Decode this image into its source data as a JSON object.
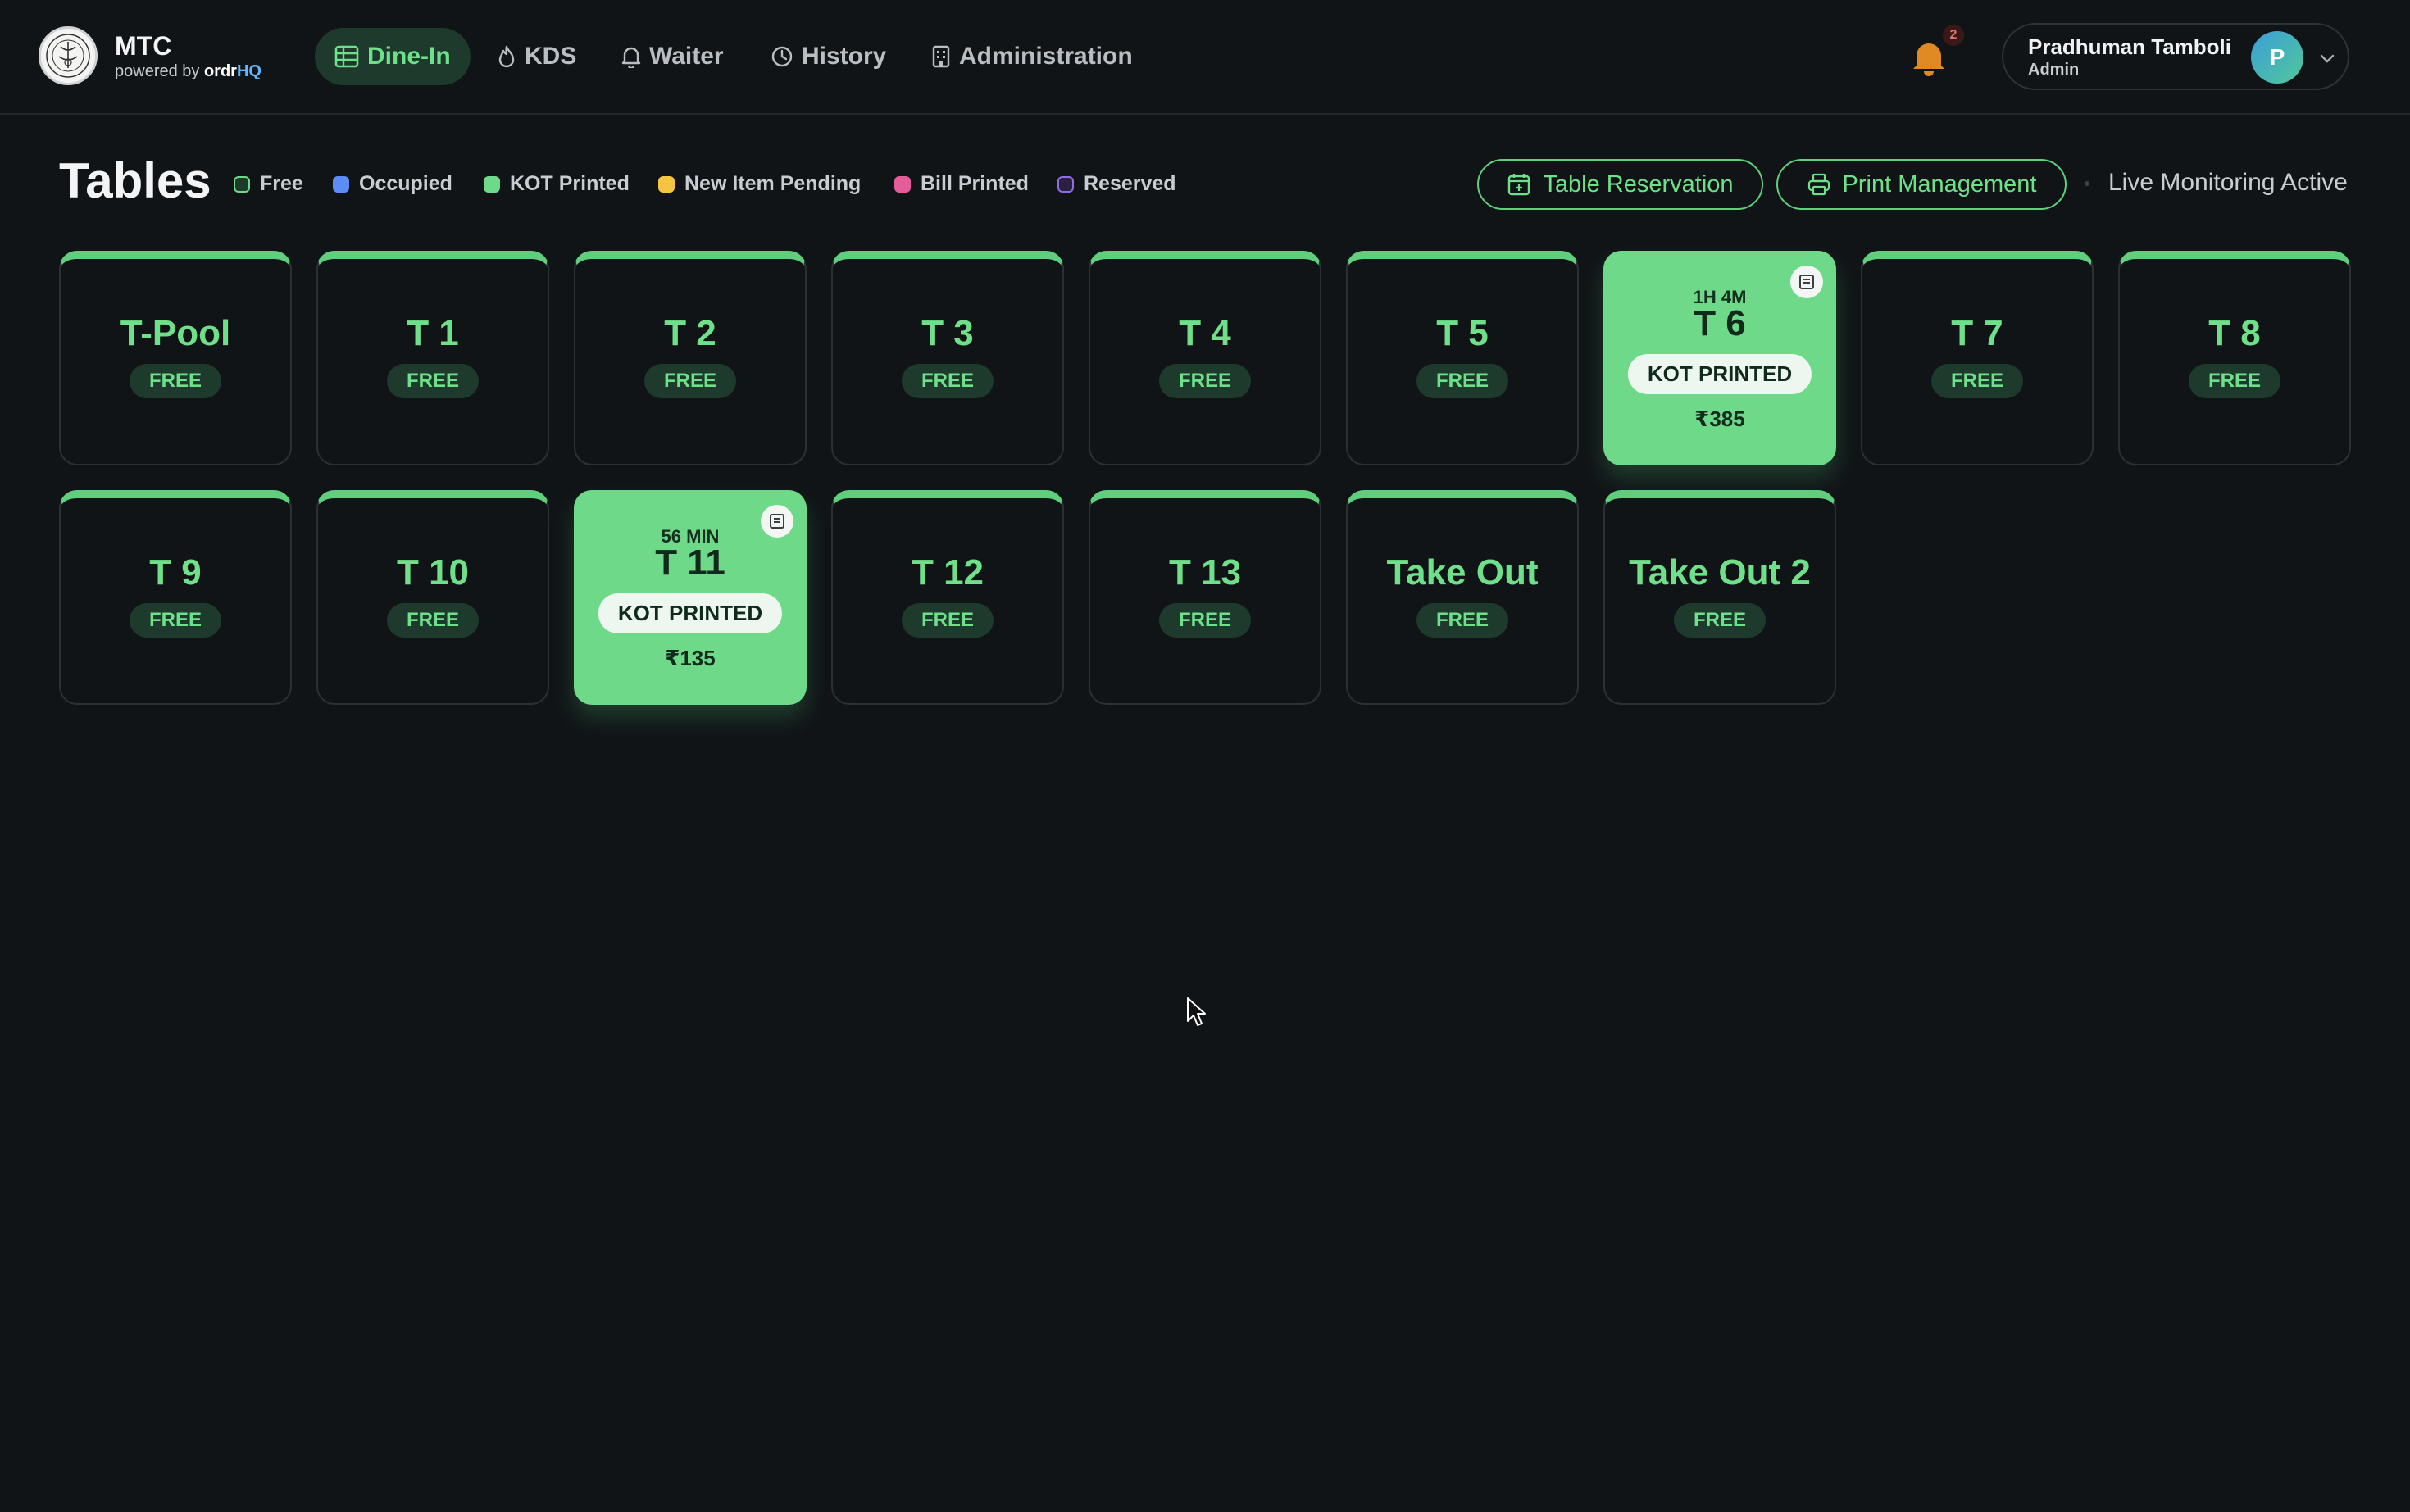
{
  "brand": {
    "name": "MTC",
    "powered_prefix": "powered by",
    "powered_name": "ordr",
    "powered_hq": "HQ"
  },
  "nav": [
    {
      "label": "Dine-In",
      "icon": "table-grid-icon",
      "active": true
    },
    {
      "label": "KDS",
      "icon": "flame-icon",
      "active": false
    },
    {
      "label": "Waiter",
      "icon": "bell-icon",
      "active": false
    },
    {
      "label": "History",
      "icon": "clock-icon",
      "active": false
    },
    {
      "label": "Administration",
      "icon": "building-icon",
      "active": false
    }
  ],
  "notifications": {
    "count": "2"
  },
  "user": {
    "name": "Pradhuman Tamboli",
    "role": "Admin",
    "initial": "P"
  },
  "page": {
    "title": "Tables"
  },
  "legend": [
    {
      "label": "Free",
      "color": "#1e3a2c"
    },
    {
      "label": "Occupied",
      "color": "#5b8df5"
    },
    {
      "label": "KOT Printed",
      "color": "#6fd98a"
    },
    {
      "label": "New Item Pending",
      "color": "#f5c542"
    },
    {
      "label": "Bill Printed",
      "color": "#e45c9a"
    },
    {
      "label": "Reserved",
      "color": "#7a5cc8"
    }
  ],
  "actions": {
    "reservation": "Table Reservation",
    "print": "Print Management",
    "live": "Live Monitoring Active"
  },
  "tables": [
    {
      "name": "T-Pool",
      "status": "FREE"
    },
    {
      "name": "T 1",
      "status": "FREE"
    },
    {
      "name": "T 2",
      "status": "FREE"
    },
    {
      "name": "T 3",
      "status": "FREE"
    },
    {
      "name": "T 4",
      "status": "FREE"
    },
    {
      "name": "T 5",
      "status": "FREE"
    },
    {
      "name": "T 6",
      "status": "KOT PRINTED",
      "time": "1H 4M",
      "amount": "₹385"
    },
    {
      "name": "T 7",
      "status": "FREE"
    },
    {
      "name": "T 8",
      "status": "FREE"
    },
    {
      "name": "T 9",
      "status": "FREE"
    },
    {
      "name": "T 10",
      "status": "FREE"
    },
    {
      "name": "T 11",
      "status": "KOT PRINTED",
      "time": "56 MIN",
      "amount": "₹135"
    },
    {
      "name": "T 12",
      "status": "FREE"
    },
    {
      "name": "T 13",
      "status": "FREE"
    },
    {
      "name": "Take Out",
      "status": "FREE"
    },
    {
      "name": "Take Out 2",
      "status": "FREE"
    }
  ],
  "colors": {
    "accent": "#6fe08a",
    "background": "#111417",
    "kot": "#6fd98a"
  }
}
